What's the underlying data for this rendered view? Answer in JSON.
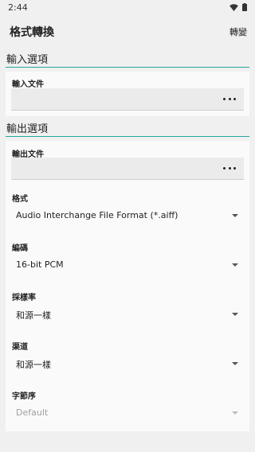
{
  "status_bar": {
    "time": "2:44"
  },
  "app_bar": {
    "title": "格式轉換",
    "action_label": "轉變"
  },
  "input_section": {
    "header": "輸入選項",
    "file_label": "輸入文件",
    "file_value": "",
    "browse_icon": "more-horiz-icon"
  },
  "output_section": {
    "header": "輸出選項",
    "file_label": "輸出文件",
    "file_value": "",
    "browse_icon": "more-horiz-icon",
    "format": {
      "label": "格式",
      "value": "Audio Interchange File Format (*.aiff)"
    },
    "encoding": {
      "label": "編碼",
      "value": "16-bit PCM"
    },
    "sample_rate": {
      "label": "採樣率",
      "value": "和源一樣"
    },
    "channels": {
      "label": "渠道",
      "value": "和源一樣"
    },
    "byte_order": {
      "label": "字節序",
      "value": "Default",
      "disabled": true
    }
  },
  "colors": {
    "accent": "#26a69a",
    "background": "#f0f0f0",
    "card": "#fafafa"
  }
}
